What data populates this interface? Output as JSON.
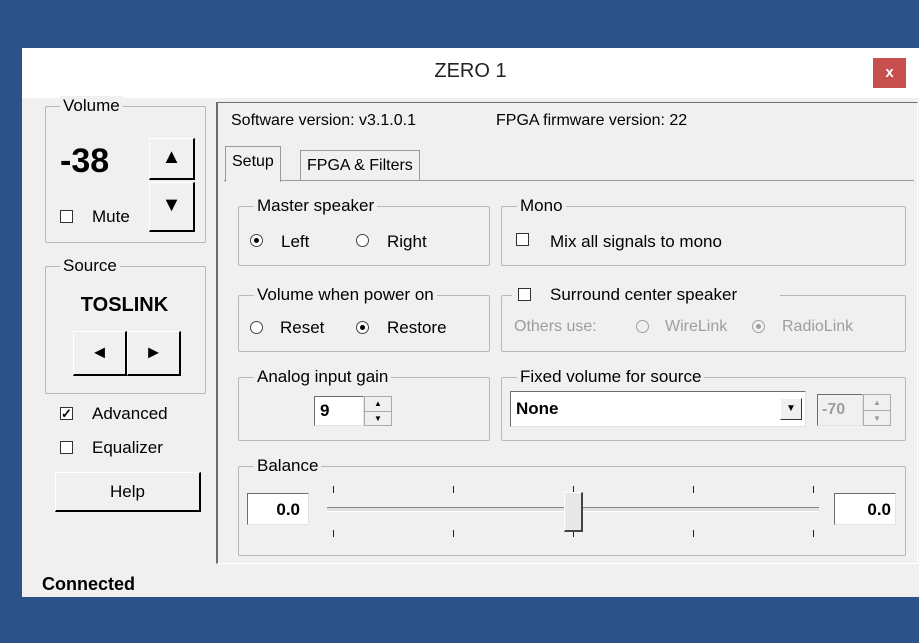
{
  "window": {
    "title": "ZERO 1",
    "close_label": "x"
  },
  "volume": {
    "group_label": "Volume",
    "value": "-38",
    "mute_label": "Mute",
    "mute_checked": false
  },
  "source": {
    "group_label": "Source",
    "value": "TOSLINK"
  },
  "advanced": {
    "label": "Advanced",
    "checked": true
  },
  "equalizer": {
    "label": "Equalizer",
    "checked": false
  },
  "help_label": "Help",
  "status": "Connected",
  "info": {
    "software_version": "Software version: v3.1.0.1",
    "fpga_version": "FPGA firmware version:  22"
  },
  "tabs": [
    {
      "label": "Setup",
      "active": true
    },
    {
      "label": "FPGA & Filters",
      "active": false
    }
  ],
  "master_speaker": {
    "label": "Master speaker",
    "options": [
      "Left",
      "Right"
    ],
    "selected": "Left"
  },
  "mono": {
    "label": "Mono",
    "checkbox_label": "Mix all signals to mono",
    "checked": false
  },
  "volume_power_on": {
    "label": "Volume when power on",
    "options": [
      "Reset",
      "Restore"
    ],
    "selected": "Restore"
  },
  "surround": {
    "label": "Surround center speaker",
    "checked": false,
    "others_use_label": "Others use:",
    "options": [
      "WireLink",
      "RadioLink"
    ],
    "selected": "RadioLink"
  },
  "analog_gain": {
    "label": "Analog input gain",
    "value": "9"
  },
  "fixed_volume": {
    "label": "Fixed volume for source",
    "selected": "None",
    "value": "-70"
  },
  "balance": {
    "label": "Balance",
    "left_value": "0.0",
    "right_value": "0.0",
    "position": 0.5
  },
  "colors": {
    "title_bar": "#2c5289",
    "close_button": "#c7504e",
    "window_bg": "#f0f0f0"
  }
}
